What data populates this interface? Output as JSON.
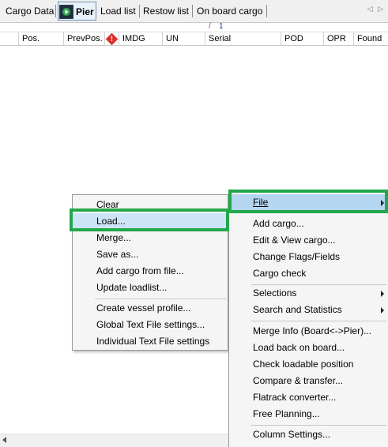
{
  "tabs": {
    "cargo_data": "Cargo Data",
    "pier": "Pier",
    "load_list": "Load list",
    "restow_list": "Restow list",
    "on_board_cargo": "On board cargo",
    "scroll_arrows": "◁ ▷"
  },
  "grid": {
    "top_marker": "1",
    "top_slash": "/",
    "columns": [
      "Pos.",
      "PrevPos.",
      "IMDG",
      "UN",
      "Serial",
      "POD",
      "OPR",
      "Found"
    ],
    "warn_glyph": "!"
  },
  "left_menu": {
    "items": [
      "Clear",
      "Load...",
      "Merge...",
      "Save as...",
      "Add cargo from file...",
      "Update loadlist...",
      "Create vessel profile...",
      "Global Text File settings...",
      "Individual Text File settings"
    ],
    "highlighted": "Load..."
  },
  "right_menu": {
    "file_label": "File",
    "items": [
      "Add cargo...",
      "Edit & View cargo...",
      "Change Flags/Fields",
      "Cargo check",
      "Selections",
      "Search and Statistics",
      "Merge Info (Board<->Pier)...",
      "Load back on board...",
      "Check loadable position",
      "Compare & transfer...",
      "Flatrack converter...",
      "Free Planning...",
      "Column Settings..."
    ]
  },
  "colors": {
    "highlight_green": "#22a84a",
    "menu_highlight": "#cce4f7",
    "tab_active": "#e9f1fb",
    "warn_red": "#d9302c"
  }
}
